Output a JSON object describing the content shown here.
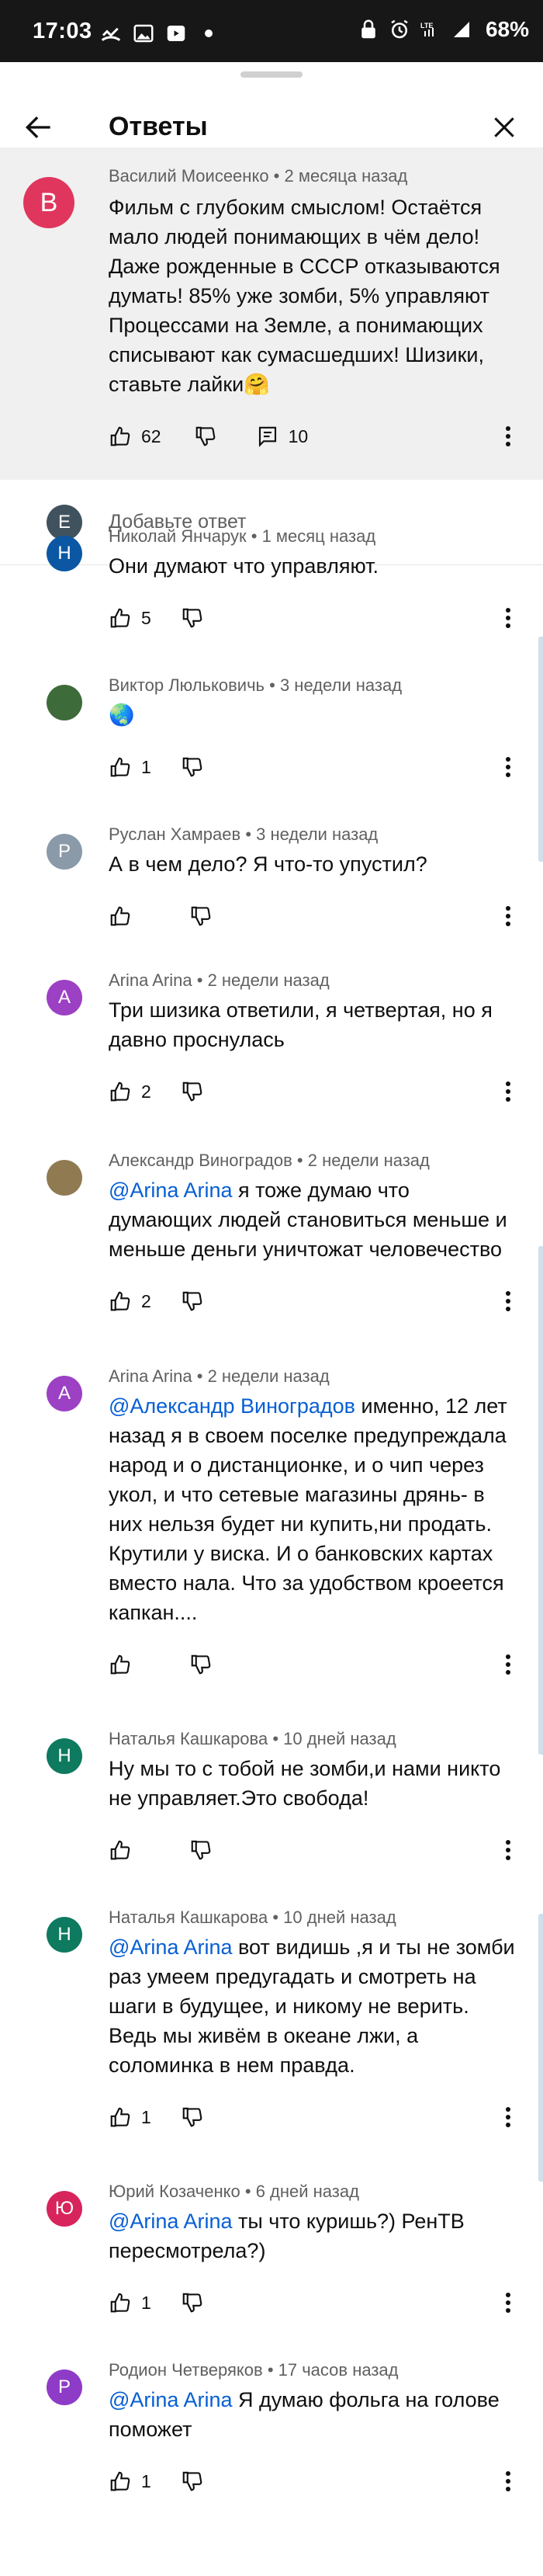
{
  "status_bar": {
    "time": "17:03",
    "battery": "68%",
    "network": "LTE"
  },
  "sheet": {
    "title": "Ответы"
  },
  "parent_comment": {
    "avatar_letter": "В",
    "author": "Василий Моисеенко",
    "time": "2 месяца назад",
    "text": "Фильм с глубоким смыслом! Остаётся мало людей понимающих в чём дело! Даже рожденные в СССР отказываются думать! 85% уже зомби, 5% управляют Процессами на Земле, а понимающих списывают как сумасшедших! Шизики, ставьте лайки🤗",
    "likes": "62",
    "replies": "10"
  },
  "add_reply": {
    "avatar_letter": "E",
    "placeholder": "Добавьте ответ"
  },
  "replies": [
    {
      "avatar_letter": "Н",
      "avatar_color": "#0b57a4",
      "author": "Николай Янчарук",
      "time": "1 месяц назад",
      "mention": "",
      "text": "Они думают что управляют.",
      "likes": "5"
    },
    {
      "avatar_letter": "",
      "avatar_color": "#3d6b3a",
      "author": "Виктор Люльковичь",
      "time": "3 недели назад",
      "mention": "",
      "text": "🌏",
      "likes": "1"
    },
    {
      "avatar_letter": "Р",
      "avatar_color": "#8a9aa8",
      "author": "Руслан Хамраев",
      "time": "3 недели назад",
      "mention": "",
      "text": "А в чем дело? Я что-то упустил?",
      "likes": ""
    },
    {
      "avatar_letter": "A",
      "avatar_color": "#9c40c4",
      "author": "Arina Arina",
      "time": "2 недели назад",
      "mention": "",
      "text": "Три шизика ответили, я четвертая, но я давно проснулась",
      "likes": "2"
    },
    {
      "avatar_letter": "",
      "avatar_color": "#8f7a52",
      "author": "Александр Виноградов",
      "time": "2 недели назад",
      "mention": "@Arina Arina",
      "text": " я тоже думаю что думающих людей становиться меньше и меньше деньги уничтожат человечество",
      "likes": "2"
    },
    {
      "avatar_letter": "A",
      "avatar_color": "#9c40c4",
      "author": "Arina Arina",
      "time": "2 недели назад",
      "mention": "@Александр Виноградов",
      "text": " именно, 12 лет назад я в своем поселке предупреждала народ и о дистанционке, и о чип через укол, и что сетевые магазины дрянь- в них нельзя будет ни купить,ни продать. Крутили у виска. И о банковских картах вместо нала. Что за удобством кроеется капкан....",
      "likes": ""
    },
    {
      "avatar_letter": "Н",
      "avatar_color": "#0e7a5f",
      "author": "Наталья Кашкарова",
      "time": "10 дней назад",
      "mention": "",
      "text": "Ну мы то с тобой не зомби,и нами никто не управляет.Это свобода!",
      "likes": ""
    },
    {
      "avatar_letter": "Н",
      "avatar_color": "#0e7a5f",
      "author": "Наталья Кашкарова",
      "time": "10 дней назад",
      "mention": "@Arina Arina",
      "text": " вот видишь ,я и ты не зомби раз умеем предугадать и смотреть на шаги в будущее, и никому не верить. Ведь мы живём в океане лжи, а соломинка в нем правда.",
      "likes": "1"
    },
    {
      "avatar_letter": "Ю",
      "avatar_color": "#d8245c",
      "author": "Юрий Козаченко",
      "time": "6 дней назад",
      "mention": "@Arina Arina",
      "text": " ты что куришь?) РенТВ пересмотрела?)",
      "likes": "1"
    },
    {
      "avatar_letter": "Р",
      "avatar_color": "#8e3bc8",
      "author": "Родион Четверяков",
      "time": "17 часов назад",
      "mention": "@Arina Arina",
      "text": " Я думаю фольга на голове поможет",
      "likes": "1"
    }
  ]
}
